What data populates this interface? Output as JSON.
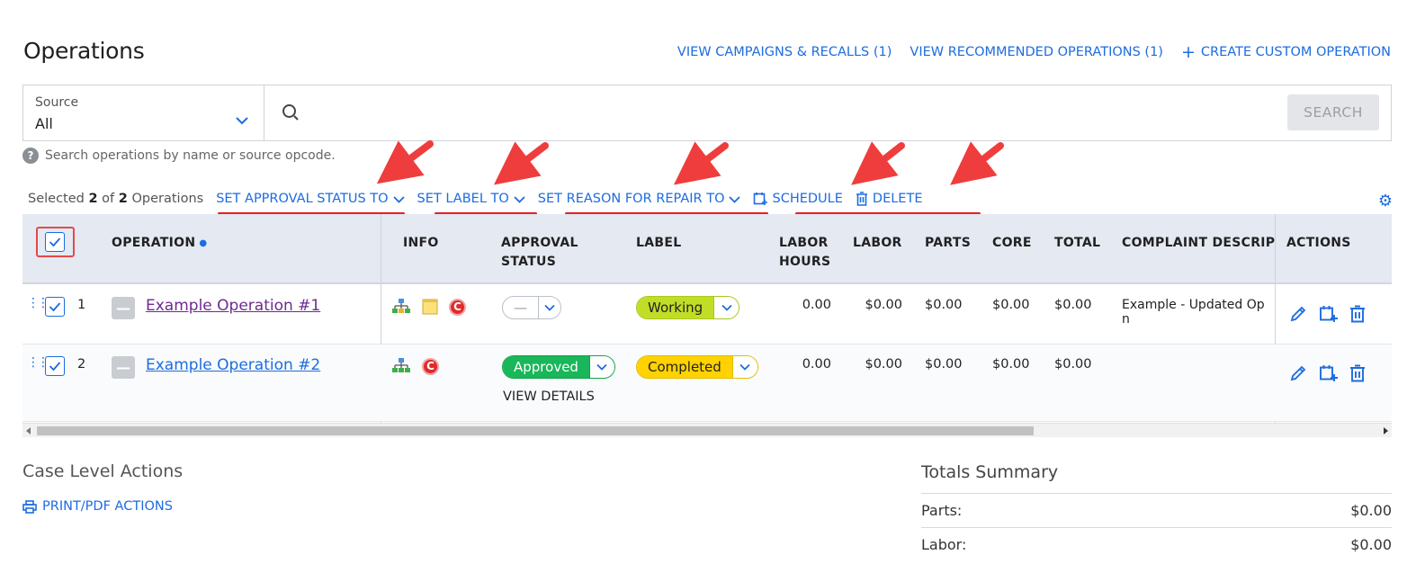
{
  "header": {
    "title": "Operations",
    "links": [
      {
        "label": "VIEW CAMPAIGNS & RECALLS (1)"
      },
      {
        "label": "VIEW RECOMMENDED OPERATIONS (1)"
      },
      {
        "label": "CREATE CUSTOM OPERATION",
        "icon": "plus-icon"
      }
    ]
  },
  "search": {
    "source_label": "Source",
    "source_value": "All",
    "placeholder": "",
    "button_label": "SEARCH",
    "hint": "Search operations by name or source opcode."
  },
  "bulk": {
    "selected_prefix": "Selected",
    "selected_count": "2",
    "of_text": "of",
    "total_count": "2",
    "suffix": "Operations",
    "actions": {
      "approval": "SET APPROVAL STATUS TO",
      "label": "SET LABEL TO",
      "reason": "SET REASON FOR REPAIR TO",
      "schedule": "SCHEDULE",
      "delete": "DELETE"
    }
  },
  "table": {
    "headers": {
      "operation": "OPERATION",
      "info": "INFO",
      "approval_1": "APPROVAL",
      "approval_2": "STATUS",
      "label": "LABEL",
      "labor_hours_1": "LABOR",
      "labor_hours_2": "HOURS",
      "labor": "LABOR",
      "parts": "PARTS",
      "core": "CORE",
      "total": "TOTAL",
      "complaint": "COMPLAINT DESCRIPT",
      "actions": "ACTIONS"
    },
    "rows": [
      {
        "index": "1",
        "name": "Example Operation #1",
        "info_icons": [
          "hierarchy-icon",
          "note-icon",
          "c-badge-icon"
        ],
        "approval": "—",
        "label": "Working",
        "labor_hours": "0.00",
        "labor": "$0.00",
        "parts": "$0.00",
        "core": "$0.00",
        "total": "$0.00",
        "complaint": "Example - Updated Op\nn"
      },
      {
        "index": "2",
        "name": "Example Operation #2",
        "info_icons": [
          "hierarchy-icon",
          "c-badge-icon"
        ],
        "approval": "Approved",
        "view_details": "VIEW DETAILS",
        "label": "Completed",
        "labor_hours": "0.00",
        "labor": "$0.00",
        "parts": "$0.00",
        "core": "$0.00",
        "total": "$0.00",
        "complaint": ""
      }
    ]
  },
  "case_actions": {
    "title": "Case Level Actions",
    "print": "PRINT/PDF ACTIONS"
  },
  "totals": {
    "title": "Totals Summary",
    "rows": [
      {
        "label": "Parts:",
        "value": "$0.00"
      },
      {
        "label": "Labor:",
        "value": "$0.00"
      }
    ]
  },
  "colors": {
    "accent": "#1d6ce0",
    "annotation": "#e41f26",
    "working": "#c2dd26",
    "completed": "#ffd200",
    "approved": "#19b65a"
  }
}
